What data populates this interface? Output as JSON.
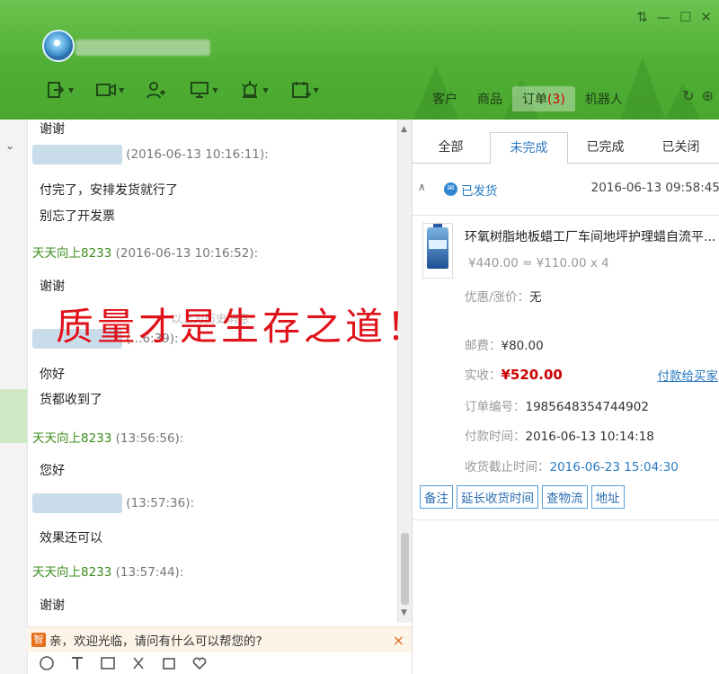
{
  "header": {
    "tabs": [
      {
        "label": "客户"
      },
      {
        "label": "商品"
      },
      {
        "label": "订单",
        "badge": "(3)"
      },
      {
        "label": "机器人"
      }
    ],
    "window_controls": [
      "pin-icon",
      "minimize-icon",
      "maximize-icon",
      "close-icon"
    ]
  },
  "chat": {
    "top_partial": "谢谢",
    "messages": [
      {
        "sender": "",
        "sender_type": "customer",
        "time": "(2016-06-13 10:16:11):",
        "lines": [
          "付完了，安排发货就行了",
          "别忘了开发票"
        ]
      },
      {
        "sender": "天天向上8233",
        "sender_type": "me",
        "time": "(2016-06-13 10:16:52):",
        "lines": [
          "谢谢"
        ]
      },
      {
        "sender": "",
        "sender_type": "customer",
        "time": "(...6:39):",
        "lines": [
          "你好",
          "货都收到了"
        ]
      },
      {
        "sender": "天天向上8233",
        "sender_type": "me",
        "time": "(13:56:56):",
        "lines": [
          "您好"
        ]
      },
      {
        "sender": "",
        "sender_type": "customer",
        "time": "(13:57:36):",
        "lines": [
          "效果还可以"
        ]
      },
      {
        "sender": "天天向上8233",
        "sender_type": "me",
        "time": "(13:57:44):",
        "lines": [
          "谢谢"
        ]
      }
    ],
    "history_hint": "以上为历史消息"
  },
  "welcome": {
    "icon_text": "智",
    "text": "亲，欢迎光临，请问有什么可以帮您的?",
    "close": "×"
  },
  "watermark": "质量才是生存之道！",
  "order_panel": {
    "tabs": [
      {
        "label": "全部"
      },
      {
        "label": "未完成",
        "active": true
      },
      {
        "label": "已完成"
      },
      {
        "label": "已关闭"
      }
    ],
    "status_label": "已发货",
    "status_time": "2016-06-13 09:58:45",
    "product_name": "环氧树脂地板蜡工厂车间地坪护理蜡自流平...",
    "product_price": "¥440.00 = ¥110.00 x 4",
    "discount_label": "优惠/涨价：",
    "discount_value": "无",
    "shipping_label": "邮费：",
    "shipping_value": "¥80.00",
    "paid_label": "实收：",
    "paid_value": "¥520.00",
    "pay_link": "付款给买家",
    "order_no_label": "订单编号：",
    "order_no": "1985648354744902",
    "pay_time_label": "付款时间：",
    "pay_time": "2016-06-13 10:14:18",
    "deadline_label": "收货截止时间：",
    "deadline": "2016-06-23 15:04:30",
    "buttons": [
      "备注",
      "延长收货时间",
      "查物流",
      "地址"
    ]
  }
}
